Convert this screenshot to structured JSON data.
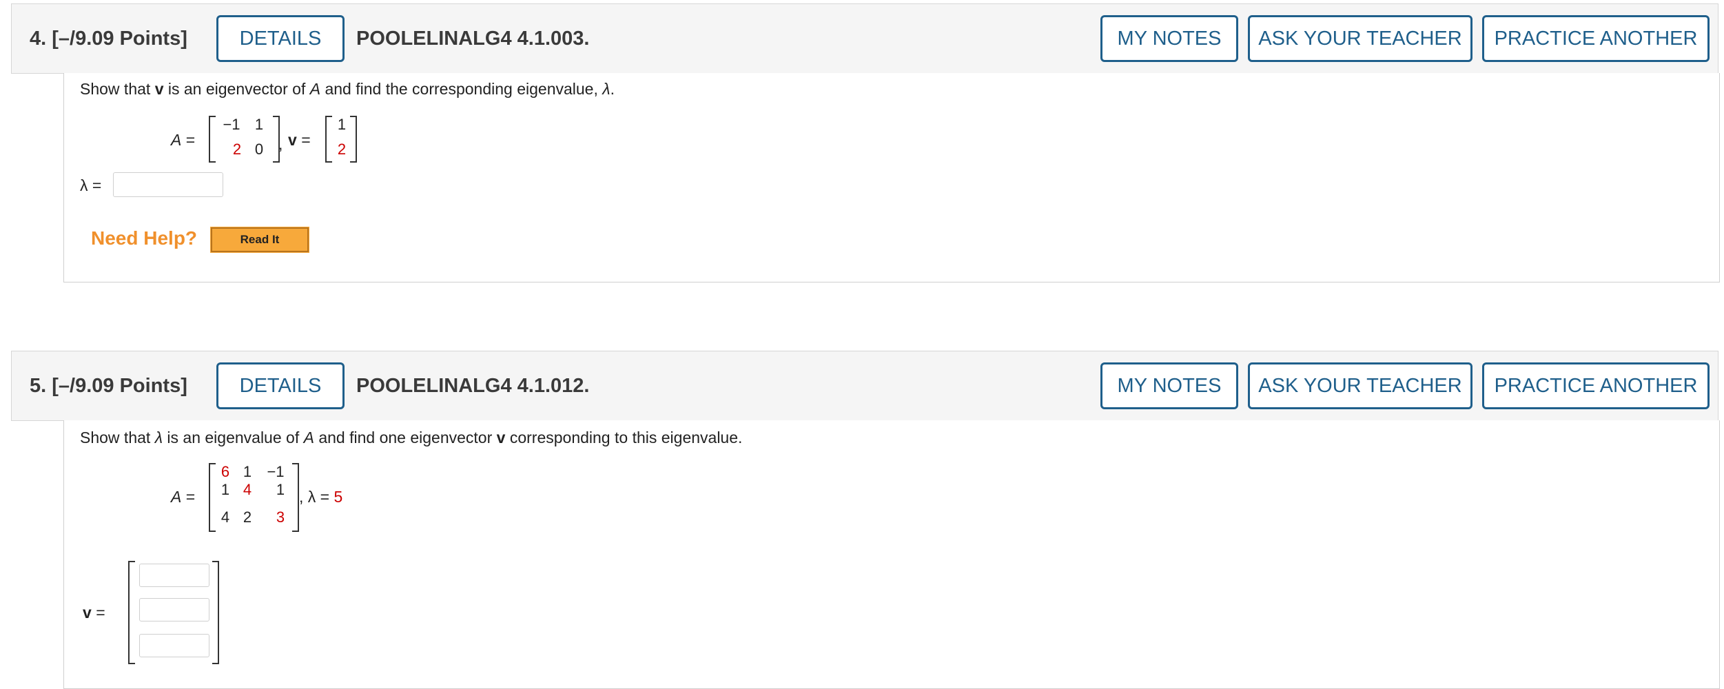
{
  "questions": [
    {
      "number": "4.",
      "points": "[–/9.09 Points]",
      "details_label": "DETAILS",
      "code": "POOLELINALG4 4.1.003.",
      "my_notes_label": "MY NOTES",
      "ask_teacher_label": "ASK YOUR TEACHER",
      "practice_label": "PRACTICE ANOTHER",
      "prompt": {
        "p1": "Show that ",
        "v": "v",
        "p2": " is an eigenvector of ",
        "A": "A",
        "p3": " and find the corresponding eigenvalue, ",
        "lambda": "λ",
        "p4": "."
      },
      "matrix_A": [
        [
          "−1",
          "1"
        ],
        [
          "2",
          "0"
        ]
      ],
      "vector_v": [
        "1",
        "2"
      ],
      "labels": {
        "A_eq": "A =",
        "comma": ",",
        "v": "v",
        "eq": "=",
        "lambda_eq": "λ ="
      },
      "answer_value": "",
      "need_help": "Need Help?",
      "read_it": "Read It"
    },
    {
      "number": "5.",
      "points": "[–/9.09 Points]",
      "details_label": "DETAILS",
      "code": "POOLELINALG4 4.1.012.",
      "my_notes_label": "MY NOTES",
      "ask_teacher_label": "ASK YOUR TEACHER",
      "practice_label": "PRACTICE ANOTHER",
      "prompt": {
        "p1": "Show that ",
        "lambda": "λ",
        "p2": " is an eigenvalue of ",
        "A": "A",
        "p3": " and find one eigenvector ",
        "v": "v",
        "p4": " corresponding to this eigenvalue."
      },
      "matrix_A": [
        [
          "6",
          "1",
          "−1"
        ],
        [
          "1",
          "4",
          "1"
        ],
        [
          "4",
          "2",
          "3"
        ]
      ],
      "lambda_value": "5",
      "labels": {
        "A_eq": "A =",
        "lambda_eq": ", λ =",
        "v_eq_v": "v",
        "v_eq": "="
      },
      "answer_vector": [
        "",
        "",
        ""
      ]
    }
  ],
  "colors": {
    "link_blue": "#1f5f8b",
    "red_value": "#cc0000",
    "help_orange": "#f0902c",
    "readit_bg": "#f7a93b"
  }
}
